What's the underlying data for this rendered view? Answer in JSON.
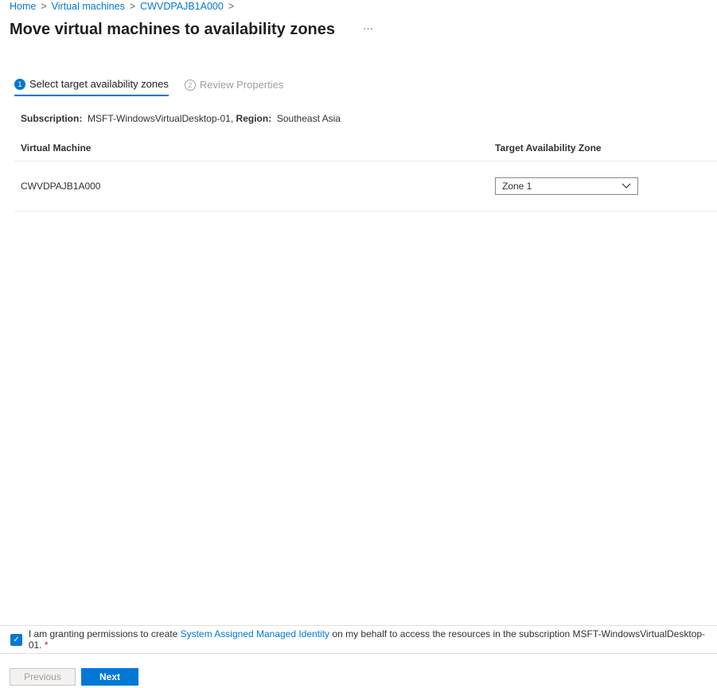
{
  "breadcrumb": [
    "Home",
    "Virtual machines",
    "CWVDPAJB1A000"
  ],
  "title": "Move virtual machines to availability zones",
  "more": "···",
  "steps": [
    {
      "num": "1",
      "label": "Select target availability zones"
    },
    {
      "num": "2",
      "label": "Review Properties"
    }
  ],
  "subscription": {
    "label": "Subscription:",
    "value": "MSFT-WindowsVirtualDesktop-01,",
    "region_label": "Region:",
    "region": "Southeast Asia"
  },
  "table": {
    "headers": [
      "Virtual Machine",
      "Target Availability Zone"
    ],
    "rows": [
      {
        "vm": "CWVDPAJB1A000",
        "zone": "Zone 1"
      }
    ]
  },
  "consent": {
    "checked": true,
    "pre": "I am granting permissions to create",
    "link": "System Assigned Managed Identity",
    "post": "on my behalf to access the resources in the subscription MSFT-WindowsVirtualDesktop-01.",
    "required": "*"
  },
  "buttons": {
    "previous": "Previous",
    "next": "Next"
  },
  "accent": "#0078d4"
}
